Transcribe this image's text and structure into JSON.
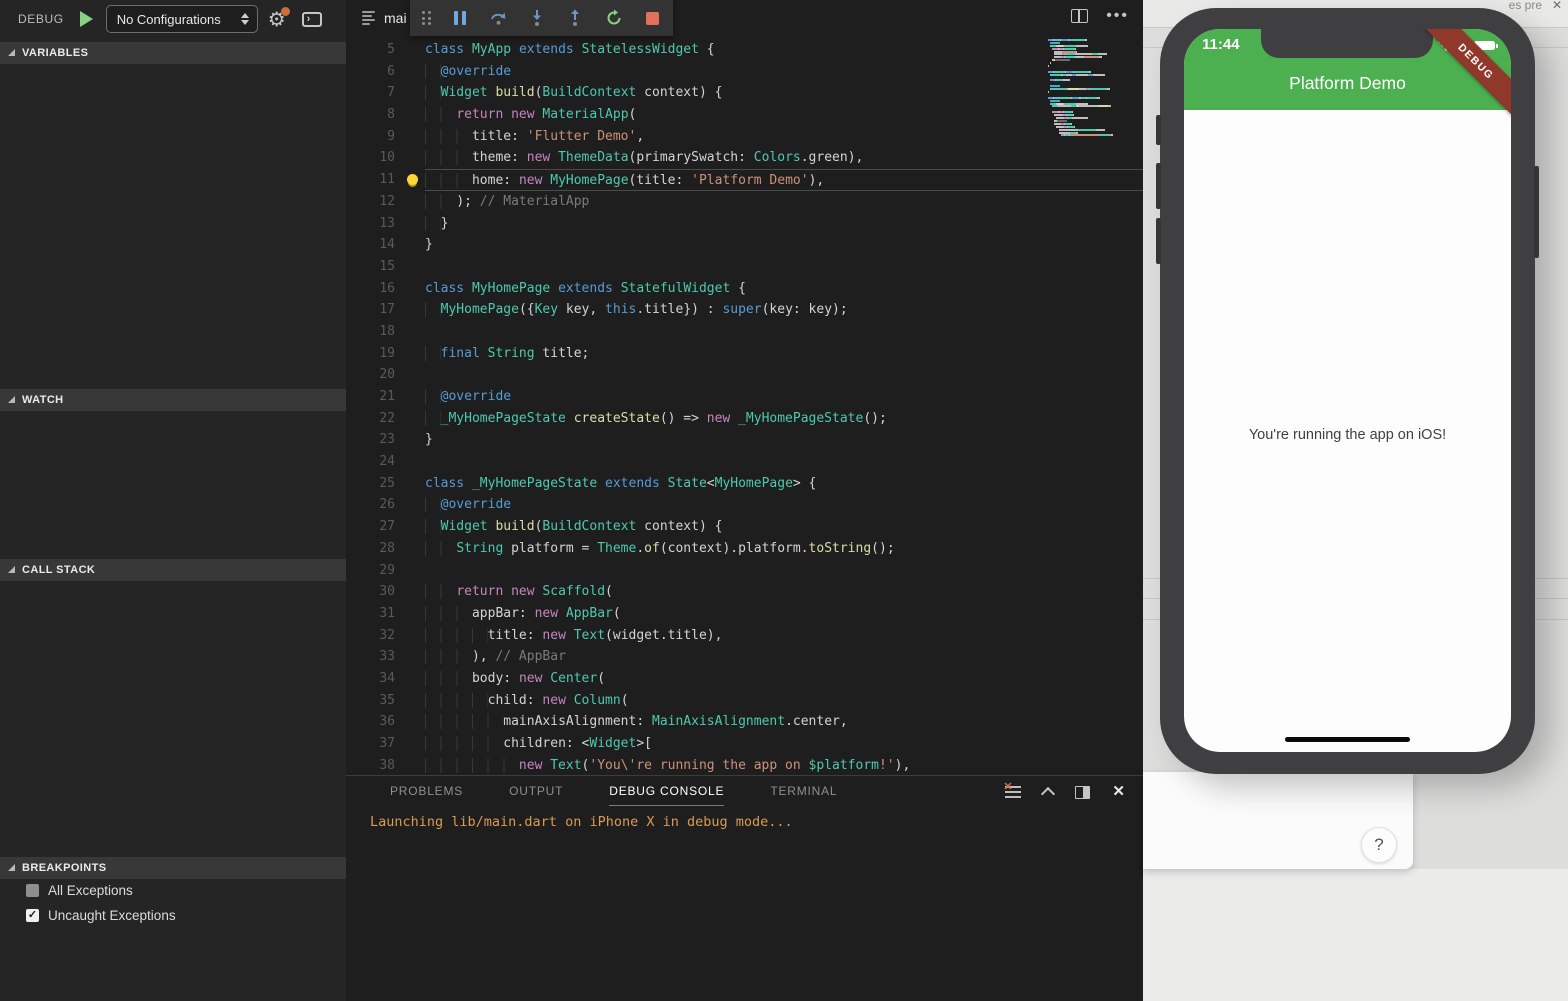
{
  "sidebar": {
    "title": "DEBUG",
    "config_dropdown": "No Configurations",
    "icons": [
      "play-icon",
      "dropdown-arrows-icon",
      "gear-icon",
      "notification-dot",
      "open-console-icon"
    ],
    "sections": [
      {
        "label": "VARIABLES"
      },
      {
        "label": "WATCH"
      },
      {
        "label": "CALL STACK"
      },
      {
        "label": "BREAKPOINTS"
      }
    ],
    "breakpoints": [
      {
        "label": "All Exceptions",
        "checked": false
      },
      {
        "label": "Uncaught Exceptions",
        "checked": true
      }
    ]
  },
  "editor": {
    "tab_label": "mai",
    "toolbar_icons": [
      "drag-grip-icon",
      "pause-icon",
      "step-over-icon",
      "step-into-icon",
      "step-out-icon",
      "restart-icon",
      "stop-icon"
    ],
    "action_icons": [
      "split-editor-icon",
      "more-actions-icon"
    ],
    "lines": [
      {
        "num": 5,
        "tokens": [
          {
            "c": "kw",
            "t": "class"
          },
          {
            "c": "pl",
            "t": " "
          },
          {
            "c": "ty",
            "t": "MyApp"
          },
          {
            "c": "pl",
            "t": " "
          },
          {
            "c": "kw",
            "t": "extends"
          },
          {
            "c": "pl",
            "t": " "
          },
          {
            "c": "ty",
            "t": "StatelessWidget"
          },
          {
            "c": "pl",
            "t": " {"
          }
        ]
      },
      {
        "num": 6,
        "tokens": [
          {
            "c": "ws",
            "t": "  "
          },
          {
            "c": "kw",
            "t": "@override"
          }
        ]
      },
      {
        "num": 7,
        "tokens": [
          {
            "c": "ws",
            "t": "  "
          },
          {
            "c": "ty",
            "t": "Widget"
          },
          {
            "c": "pl",
            "t": " "
          },
          {
            "c": "fn",
            "t": "build"
          },
          {
            "c": "pl",
            "t": "("
          },
          {
            "c": "ty",
            "t": "BuildContext"
          },
          {
            "c": "pl",
            "t": " context) {"
          }
        ]
      },
      {
        "num": 8,
        "tokens": [
          {
            "c": "ws",
            "t": "    "
          },
          {
            "c": "ctl",
            "t": "return"
          },
          {
            "c": "pl",
            "t": " "
          },
          {
            "c": "ctl",
            "t": "new"
          },
          {
            "c": "pl",
            "t": " "
          },
          {
            "c": "ty",
            "t": "MaterialApp"
          },
          {
            "c": "pl",
            "t": "("
          }
        ]
      },
      {
        "num": 9,
        "tokens": [
          {
            "c": "ws",
            "t": "      "
          },
          {
            "c": "pl",
            "t": "title: "
          },
          {
            "c": "str",
            "t": "'Flutter Demo'"
          },
          {
            "c": "pl",
            "t": ","
          }
        ]
      },
      {
        "num": 10,
        "tokens": [
          {
            "c": "ws",
            "t": "      "
          },
          {
            "c": "pl",
            "t": "theme: "
          },
          {
            "c": "ctl",
            "t": "new"
          },
          {
            "c": "pl",
            "t": " "
          },
          {
            "c": "ty",
            "t": "ThemeData"
          },
          {
            "c": "pl",
            "t": "(primarySwatch: "
          },
          {
            "c": "ty",
            "t": "Colors"
          },
          {
            "c": "pl",
            "t": ".green),"
          }
        ]
      },
      {
        "num": 11,
        "active": true,
        "bulb": true,
        "tokens": [
          {
            "c": "ws",
            "t": "      "
          },
          {
            "c": "pl",
            "t": "home: "
          },
          {
            "c": "ctl",
            "t": "new"
          },
          {
            "c": "pl",
            "t": " "
          },
          {
            "c": "ty",
            "t": "MyHomePage"
          },
          {
            "c": "pl",
            "t": "(title: "
          },
          {
            "c": "str",
            "t": "'Platform Demo'"
          },
          {
            "c": "pl",
            "t": "),"
          }
        ]
      },
      {
        "num": 12,
        "tokens": [
          {
            "c": "ws",
            "t": "    "
          },
          {
            "c": "pl",
            "t": "); "
          },
          {
            "c": "cm",
            "t": "// MaterialApp"
          }
        ]
      },
      {
        "num": 13,
        "tokens": [
          {
            "c": "ws",
            "t": "  "
          },
          {
            "c": "pl",
            "t": "}"
          }
        ]
      },
      {
        "num": 14,
        "tokens": [
          {
            "c": "pl",
            "t": "}"
          }
        ]
      },
      {
        "num": 15,
        "tokens": []
      },
      {
        "num": 16,
        "tokens": [
          {
            "c": "kw",
            "t": "class"
          },
          {
            "c": "pl",
            "t": " "
          },
          {
            "c": "ty",
            "t": "MyHomePage"
          },
          {
            "c": "pl",
            "t": " "
          },
          {
            "c": "kw",
            "t": "extends"
          },
          {
            "c": "pl",
            "t": " "
          },
          {
            "c": "ty",
            "t": "StatefulWidget"
          },
          {
            "c": "pl",
            "t": " {"
          }
        ]
      },
      {
        "num": 17,
        "tokens": [
          {
            "c": "ws",
            "t": "  "
          },
          {
            "c": "ty",
            "t": "MyHomePage"
          },
          {
            "c": "pl",
            "t": "({"
          },
          {
            "c": "ty",
            "t": "Key"
          },
          {
            "c": "pl",
            "t": " key, "
          },
          {
            "c": "kw",
            "t": "this"
          },
          {
            "c": "pl",
            "t": ".title}) : "
          },
          {
            "c": "kw",
            "t": "super"
          },
          {
            "c": "pl",
            "t": "(key: key);"
          }
        ]
      },
      {
        "num": 18,
        "tokens": []
      },
      {
        "num": 19,
        "tokens": [
          {
            "c": "ws",
            "t": "  "
          },
          {
            "c": "kw",
            "t": "final"
          },
          {
            "c": "pl",
            "t": " "
          },
          {
            "c": "ty",
            "t": "String"
          },
          {
            "c": "pl",
            "t": " title;"
          }
        ]
      },
      {
        "num": 20,
        "tokens": []
      },
      {
        "num": 21,
        "tokens": [
          {
            "c": "ws",
            "t": "  "
          },
          {
            "c": "kw",
            "t": "@override"
          }
        ]
      },
      {
        "num": 22,
        "tokens": [
          {
            "c": "ws",
            "t": "  "
          },
          {
            "c": "ty",
            "t": "_MyHomePageState"
          },
          {
            "c": "pl",
            "t": " "
          },
          {
            "c": "fn",
            "t": "createState"
          },
          {
            "c": "pl",
            "t": "() => "
          },
          {
            "c": "ctl",
            "t": "new"
          },
          {
            "c": "pl",
            "t": " "
          },
          {
            "c": "ty",
            "t": "_MyHomePageState"
          },
          {
            "c": "pl",
            "t": "();"
          }
        ]
      },
      {
        "num": 23,
        "tokens": [
          {
            "c": "pl",
            "t": "}"
          }
        ]
      },
      {
        "num": 24,
        "tokens": []
      },
      {
        "num": 25,
        "tokens": [
          {
            "c": "kw",
            "t": "class"
          },
          {
            "c": "pl",
            "t": " "
          },
          {
            "c": "ty",
            "t": "_MyHomePageState"
          },
          {
            "c": "pl",
            "t": " "
          },
          {
            "c": "kw",
            "t": "extends"
          },
          {
            "c": "pl",
            "t": " "
          },
          {
            "c": "ty",
            "t": "State"
          },
          {
            "c": "pl",
            "t": "<"
          },
          {
            "c": "ty",
            "t": "MyHomePage"
          },
          {
            "c": "pl",
            "t": "> {"
          }
        ]
      },
      {
        "num": 26,
        "tokens": [
          {
            "c": "ws",
            "t": "  "
          },
          {
            "c": "kw",
            "t": "@override"
          }
        ]
      },
      {
        "num": 27,
        "tokens": [
          {
            "c": "ws",
            "t": "  "
          },
          {
            "c": "ty",
            "t": "Widget"
          },
          {
            "c": "pl",
            "t": " "
          },
          {
            "c": "fn",
            "t": "build"
          },
          {
            "c": "pl",
            "t": "("
          },
          {
            "c": "ty",
            "t": "BuildContext"
          },
          {
            "c": "pl",
            "t": " context) {"
          }
        ]
      },
      {
        "num": 28,
        "tokens": [
          {
            "c": "ws",
            "t": "    "
          },
          {
            "c": "ty",
            "t": "String"
          },
          {
            "c": "pl",
            "t": " platform = "
          },
          {
            "c": "ty",
            "t": "Theme"
          },
          {
            "c": "pl",
            "t": "."
          },
          {
            "c": "fn",
            "t": "of"
          },
          {
            "c": "pl",
            "t": "(context).platform."
          },
          {
            "c": "fn",
            "t": "toString"
          },
          {
            "c": "pl",
            "t": "();"
          }
        ]
      },
      {
        "num": 29,
        "tokens": []
      },
      {
        "num": 30,
        "tokens": [
          {
            "c": "ws",
            "t": "    "
          },
          {
            "c": "ctl",
            "t": "return"
          },
          {
            "c": "pl",
            "t": " "
          },
          {
            "c": "ctl",
            "t": "new"
          },
          {
            "c": "pl",
            "t": " "
          },
          {
            "c": "ty",
            "t": "Scaffold"
          },
          {
            "c": "pl",
            "t": "("
          }
        ]
      },
      {
        "num": 31,
        "tokens": [
          {
            "c": "ws",
            "t": "      "
          },
          {
            "c": "pl",
            "t": "appBar: "
          },
          {
            "c": "ctl",
            "t": "new"
          },
          {
            "c": "pl",
            "t": " "
          },
          {
            "c": "ty",
            "t": "AppBar"
          },
          {
            "c": "pl",
            "t": "("
          }
        ]
      },
      {
        "num": 32,
        "tokens": [
          {
            "c": "ws",
            "t": "        "
          },
          {
            "c": "pl",
            "t": "title: "
          },
          {
            "c": "ctl",
            "t": "new"
          },
          {
            "c": "pl",
            "t": " "
          },
          {
            "c": "ty",
            "t": "Text"
          },
          {
            "c": "pl",
            "t": "(widget.title),"
          }
        ]
      },
      {
        "num": 33,
        "tokens": [
          {
            "c": "ws",
            "t": "      "
          },
          {
            "c": "pl",
            "t": "), "
          },
          {
            "c": "cm",
            "t": "// AppBar"
          }
        ]
      },
      {
        "num": 34,
        "tokens": [
          {
            "c": "ws",
            "t": "      "
          },
          {
            "c": "pl",
            "t": "body: "
          },
          {
            "c": "ctl",
            "t": "new"
          },
          {
            "c": "pl",
            "t": " "
          },
          {
            "c": "ty",
            "t": "Center"
          },
          {
            "c": "pl",
            "t": "("
          }
        ]
      },
      {
        "num": 35,
        "tokens": [
          {
            "c": "ws",
            "t": "        "
          },
          {
            "c": "pl",
            "t": "child: "
          },
          {
            "c": "ctl",
            "t": "new"
          },
          {
            "c": "pl",
            "t": " "
          },
          {
            "c": "ty",
            "t": "Column"
          },
          {
            "c": "pl",
            "t": "("
          }
        ]
      },
      {
        "num": 36,
        "tokens": [
          {
            "c": "ws",
            "t": "          "
          },
          {
            "c": "pl",
            "t": "mainAxisAlignment: "
          },
          {
            "c": "ty",
            "t": "MainAxisAlignment"
          },
          {
            "c": "pl",
            "t": ".center,"
          }
        ]
      },
      {
        "num": 37,
        "tokens": [
          {
            "c": "ws",
            "t": "          "
          },
          {
            "c": "pl",
            "t": "children: <"
          },
          {
            "c": "ty",
            "t": "Widget"
          },
          {
            "c": "pl",
            "t": ">["
          }
        ]
      },
      {
        "num": 38,
        "tokens": [
          {
            "c": "ws",
            "t": "            "
          },
          {
            "c": "ctl",
            "t": "new"
          },
          {
            "c": "pl",
            "t": " "
          },
          {
            "c": "ty",
            "t": "Text"
          },
          {
            "c": "pl",
            "t": "("
          },
          {
            "c": "str",
            "t": "'You\\'re running the app on "
          },
          {
            "c": "ty",
            "t": "$platform"
          },
          {
            "c": "str",
            "t": "!'"
          },
          {
            "c": "pl",
            "t": "),"
          }
        ]
      }
    ]
  },
  "panel": {
    "tabs": [
      "PROBLEMS",
      "OUTPUT",
      "DEBUG CONSOLE",
      "TERMINAL"
    ],
    "active_tab": "DEBUG CONSOLE",
    "console_output": "Launching lib/main.dart on iPhone X in debug mode...",
    "icons": [
      "clear-console-icon",
      "chevron-up-icon",
      "maximize-panel-icon",
      "close-panel-icon"
    ]
  },
  "simulator": {
    "status_time": "11:44",
    "status_icons": [
      "signal-dots-icon",
      "wifi-icon",
      "battery-icon"
    ],
    "app_bar_title": "Platform Demo",
    "body_text": "You're running the app on iOS!",
    "debug_banner": "DEBUG",
    "help_button": "?"
  },
  "background": {
    "tab_text": "es pre",
    "tab_close": "✕"
  },
  "colors": {
    "appbar_green": "#4CAF50",
    "banner_red": "#90392B",
    "console_orange": "#D99C55",
    "restart_green": "#89D185",
    "stop_red": "#E2705C",
    "pause_blue": "#6FA9E0"
  }
}
